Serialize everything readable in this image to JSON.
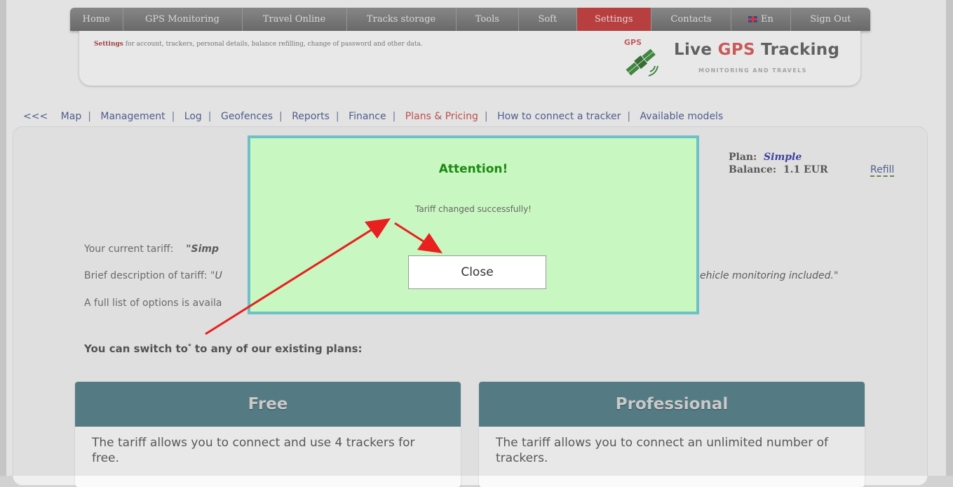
{
  "topnav": {
    "items": [
      "Home",
      "GPS Monitoring",
      "Travel Online",
      "Tracks storage",
      "Tools",
      "Soft",
      "Settings",
      "Contacts",
      "En",
      "Sign Out"
    ],
    "active": "Settings"
  },
  "header": {
    "desc_bold": "Settings",
    "desc_rest": " for account, trackers, personal details, balance refilling, change of password and other data.",
    "logo_small": "GPS",
    "logo_title_pre": "Live ",
    "logo_title_red": "GPS",
    "logo_title_post": " Tracking",
    "logo_sub": "MONITORING AND TRAVELS"
  },
  "subnav": {
    "back": "<<<",
    "items": [
      "Map",
      "Management",
      "Log",
      "Geofences",
      "Reports",
      "Finance",
      "Plans & Pricing",
      "How to connect a tracker",
      "Available models"
    ],
    "current": "Plans & Pricing"
  },
  "account": {
    "plan_label": "Plan:",
    "plan_value": "Simple",
    "balance_label": "Balance:",
    "balance_value": "1.1 EUR",
    "refill": "Refill"
  },
  "content": {
    "current_tariff_label": "Your current tariff:",
    "current_tariff_value": "\"Simp",
    "brief_label": "Brief description of tariff: \"",
    "brief_value_start": "U",
    "brief_value_end": "ehicle monitoring included.\"",
    "full_list": "A full list of options is availa",
    "switch_text": "You can switch to",
    "switch_sup": "*",
    "switch_rest": " to any of our existing plans:"
  },
  "plans": [
    {
      "name": "Free",
      "text": "The tariff allows you to connect and use 4 trackers for free."
    },
    {
      "name": "Professional",
      "text": "The tariff allows you to connect an unlimited number of trackers."
    }
  ],
  "modal": {
    "title": "Attention!",
    "message": "Tariff changed successfully!",
    "close": "Close"
  },
  "colors": {
    "active_tab": "#c23a3a",
    "modal_bg": "#c9f7c1",
    "modal_border": "#6ec0c8",
    "card_head": "#517e88",
    "arrow": "#e82020"
  }
}
